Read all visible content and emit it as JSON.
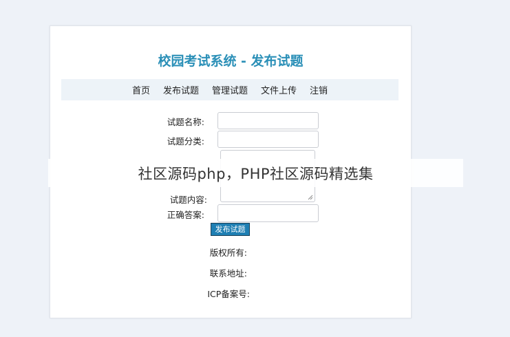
{
  "header": {
    "title": "校园考试系统 - 发布试题"
  },
  "nav": {
    "items": [
      "首页",
      "发布试题",
      "管理试题",
      "文件上传",
      "注销"
    ]
  },
  "form": {
    "name_label": "试题名称:",
    "category_label": "试题分类:",
    "content_label": "试题内容:",
    "answer_label": "正确答案:",
    "submit_label": "发布试题"
  },
  "footer": {
    "copyright": "版权所有:",
    "address": "联系地址:",
    "icp": "ICP备案号:"
  },
  "overlay": {
    "caption": "社区源码php，PHP社区源码精选集"
  },
  "colors": {
    "title": "#2a8fb7",
    "nav_bg": "#edf3f8",
    "button": "#1f7fb3"
  }
}
